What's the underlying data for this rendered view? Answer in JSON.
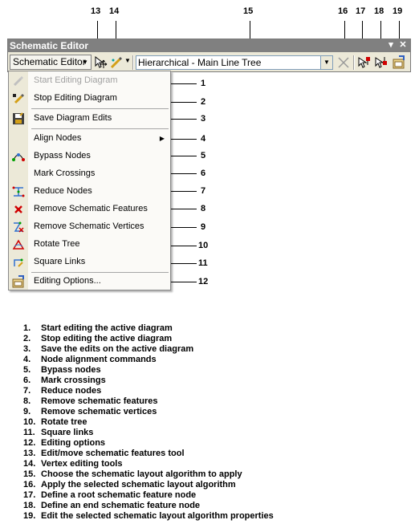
{
  "callouts_top": [
    "13",
    "14",
    "15",
    "16",
    "17",
    "18",
    "19"
  ],
  "callouts_side": [
    "1",
    "2",
    "3",
    "4",
    "5",
    "6",
    "7",
    "8",
    "9",
    "10",
    "11",
    "12"
  ],
  "toolbar": {
    "title": "Schematic Editor",
    "menu_button_label": "Schematic Editor",
    "layout_combo_value": "Hierarchical - Main Line Tree",
    "title_buttons": [
      "dropdown-arrow",
      "close"
    ]
  },
  "menu": {
    "items": [
      {
        "label": "Start Editing Diagram",
        "icon": "pencil-icon",
        "disabled": true
      },
      {
        "label": "Stop Editing Diagram",
        "icon": "pencil-stop-icon",
        "disabled": false
      },
      {
        "label": "Save Diagram Edits",
        "icon": "save-icon",
        "disabled": false
      },
      {
        "label": "Align Nodes",
        "icon": "",
        "disabled": false,
        "submenu": true
      },
      {
        "label": "Bypass Nodes",
        "icon": "bypass-nodes-icon",
        "disabled": false
      },
      {
        "label": "Mark Crossings",
        "icon": "",
        "disabled": false
      },
      {
        "label": "Reduce Nodes",
        "icon": "reduce-nodes-icon",
        "disabled": false
      },
      {
        "label": "Remove Schematic Features",
        "icon": "red-x-icon",
        "disabled": false
      },
      {
        "label": "Remove Schematic Vertices",
        "icon": "remove-vertices-icon",
        "disabled": false
      },
      {
        "label": "Rotate Tree",
        "icon": "rotate-tree-icon",
        "disabled": false
      },
      {
        "label": "Square Links",
        "icon": "square-links-icon",
        "disabled": false
      },
      {
        "label": "Editing Options...",
        "icon": "editing-options-icon",
        "disabled": false
      }
    ]
  },
  "legend": [
    {
      "num": "1.",
      "text": "Start editing the active diagram"
    },
    {
      "num": "2.",
      "text": "Stop editing the active diagram"
    },
    {
      "num": "3.",
      "text": "Save the edits on the active diagram"
    },
    {
      "num": "4.",
      "text": "Node alignment commands"
    },
    {
      "num": "5.",
      "text": "Bypass nodes"
    },
    {
      "num": "6.",
      "text": "Mark crossings"
    },
    {
      "num": "7.",
      "text": "Reduce nodes"
    },
    {
      "num": "8.",
      "text": "Remove schematic features"
    },
    {
      "num": "9.",
      "text": "Remove schematic vertices"
    },
    {
      "num": "10.",
      "text": "Rotate tree"
    },
    {
      "num": "11.",
      "text": "Square links"
    },
    {
      "num": "12.",
      "text": "Editing options"
    },
    {
      "num": "13.",
      "text": "Edit/move schematic features tool"
    },
    {
      "num": "14.",
      "text": "Vertex editing tools"
    },
    {
      "num": "15.",
      "text": "Choose the schematic layout algorithm to apply"
    },
    {
      "num": "16.",
      "text": "Apply the selected schematic layout algorithm"
    },
    {
      "num": "17.",
      "text": "Define a root schematic feature node"
    },
    {
      "num": "18.",
      "text": "Define an end schematic feature node"
    },
    {
      "num": "19.",
      "text": "Edit the selected schematic layout algorithm properties"
    }
  ],
  "colors": {
    "titlebar": "#808080",
    "toolbar_bg": "#ece9d8",
    "menu_bg": "#fbfaf7",
    "disabled_text": "#a0a0a0",
    "combo_border": "#7f9db9"
  }
}
